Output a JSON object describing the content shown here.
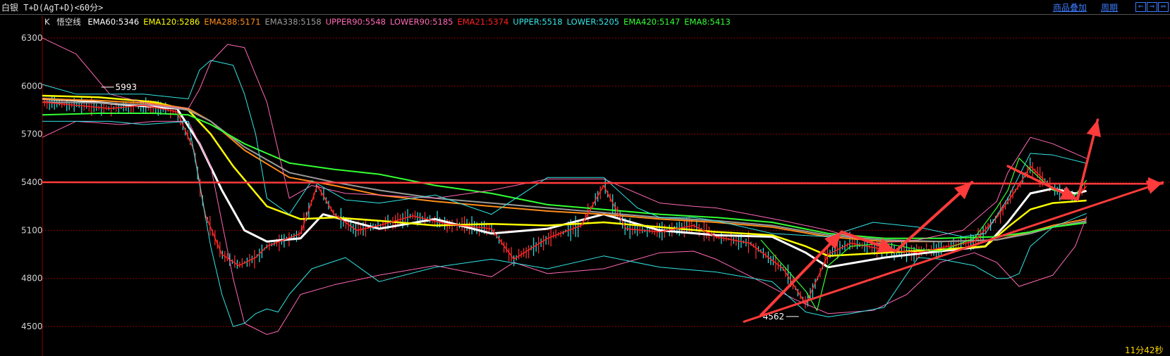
{
  "header": {
    "title": "白银 T+D(AgT+D)<60分>",
    "goods_overlay": "商品叠加",
    "period": "周期",
    "nav_left": "⇐",
    "nav_right": "⇒",
    "nav_fit": "⇔"
  },
  "legend": {
    "k_label": "K",
    "wukong_label": "悟空线",
    "items": [
      {
        "text": "EMA60:5346",
        "color": "#ffffff"
      },
      {
        "text": "EMA120:5286",
        "color": "#ffff00"
      },
      {
        "text": "EMA288:5171",
        "color": "#ff8c1a"
      },
      {
        "text": "EMA338:5158",
        "color": "#999999"
      },
      {
        "text": "UPPER90:5548",
        "color": "#ff69b4"
      },
      {
        "text": "LOWER90:5185",
        "color": "#ff69b4"
      },
      {
        "text": "EMA21:5374",
        "color": "#ff2020"
      },
      {
        "text": "UPPER:5518",
        "color": "#33e6e6"
      },
      {
        "text": "LOWER:5205",
        "color": "#33e6e6"
      },
      {
        "text": "EMA420:5147",
        "color": "#33ff33"
      },
      {
        "text": "EMA8:5413",
        "color": "#33ff33"
      }
    ]
  },
  "footer": {
    "time_remaining": "11分42秒"
  },
  "colors": {
    "background": "#000000",
    "grid": "#8b0000",
    "axis_text": "#cfcfcf",
    "arrow": "#ff3b3b",
    "candle_up": "#ff3333",
    "candle_down": "#33e6e6"
  },
  "chart_data": {
    "type": "line",
    "y_ticks": [
      4500,
      4800,
      5100,
      5400,
      5700,
      6000,
      6300
    ],
    "ylim": [
      4430,
      6370
    ],
    "grid": true,
    "annotations": [
      {
        "text": "5993",
        "x": 0.06,
        "y": 5993
      },
      {
        "text": "4562",
        "x": 0.67,
        "y": 4562
      }
    ],
    "series": [
      {
        "name": "EMA60",
        "color": "#ffffff",
        "x": [
          0,
          0.03,
          0.08,
          0.12,
          0.14,
          0.16,
          0.18,
          0.2,
          0.23,
          0.25,
          0.3,
          0.35,
          0.4,
          0.45,
          0.5,
          0.55,
          0.6,
          0.65,
          0.68,
          0.7,
          0.75,
          0.8,
          0.84,
          0.86,
          0.88,
          0.9,
          0.92,
          0.93
        ],
        "y": [
          5920,
          5910,
          5880,
          5860,
          5640,
          5350,
          5100,
          5030,
          5050,
          5200,
          5110,
          5170,
          5080,
          5110,
          5200,
          5100,
          5070,
          5060,
          4960,
          4870,
          4930,
          4970,
          5000,
          5150,
          5330,
          5360,
          5330,
          5346
        ]
      },
      {
        "name": "EMA120",
        "color": "#ffff00",
        "x": [
          0,
          0.05,
          0.1,
          0.13,
          0.15,
          0.17,
          0.2,
          0.23,
          0.26,
          0.3,
          0.35,
          0.4,
          0.45,
          0.5,
          0.55,
          0.6,
          0.65,
          0.68,
          0.7,
          0.75,
          0.8,
          0.84,
          0.86,
          0.88,
          0.9,
          0.93
        ],
        "y": [
          5940,
          5930,
          5900,
          5850,
          5700,
          5500,
          5250,
          5170,
          5180,
          5160,
          5130,
          5140,
          5130,
          5150,
          5120,
          5090,
          5070,
          5000,
          4940,
          4960,
          4980,
          5000,
          5120,
          5230,
          5270,
          5286
        ]
      },
      {
        "name": "EMA288",
        "color": "#ff8c1a",
        "x": [
          0,
          0.05,
          0.1,
          0.13,
          0.15,
          0.18,
          0.22,
          0.26,
          0.3,
          0.35,
          0.4,
          0.45,
          0.5,
          0.55,
          0.6,
          0.65,
          0.7,
          0.75,
          0.8,
          0.85,
          0.88,
          0.9,
          0.93
        ],
        "y": [
          5920,
          5910,
          5890,
          5860,
          5780,
          5600,
          5430,
          5380,
          5320,
          5280,
          5250,
          5220,
          5200,
          5170,
          5150,
          5120,
          5060,
          5030,
          5030,
          5040,
          5090,
          5130,
          5171
        ]
      },
      {
        "name": "EMA338",
        "color": "#999999",
        "x": [
          0,
          0.05,
          0.1,
          0.13,
          0.15,
          0.18,
          0.22,
          0.26,
          0.3,
          0.35,
          0.4,
          0.45,
          0.5,
          0.55,
          0.6,
          0.65,
          0.7,
          0.75,
          0.8,
          0.85,
          0.88,
          0.9,
          0.93
        ],
        "y": [
          5900,
          5895,
          5880,
          5850,
          5780,
          5620,
          5460,
          5400,
          5350,
          5300,
          5270,
          5240,
          5210,
          5180,
          5160,
          5130,
          5070,
          5040,
          5030,
          5040,
          5080,
          5120,
          5158
        ]
      },
      {
        "name": "EMA420",
        "color": "#33ff33",
        "x": [
          0,
          0.05,
          0.1,
          0.13,
          0.15,
          0.18,
          0.22,
          0.26,
          0.3,
          0.35,
          0.4,
          0.45,
          0.5,
          0.55,
          0.6,
          0.65,
          0.7,
          0.75,
          0.8,
          0.85,
          0.88,
          0.9,
          0.93
        ],
        "y": [
          5820,
          5830,
          5830,
          5820,
          5760,
          5640,
          5520,
          5480,
          5450,
          5380,
          5330,
          5260,
          5230,
          5200,
          5180,
          5150,
          5080,
          5050,
          5050,
          5060,
          5090,
          5120,
          5147
        ]
      },
      {
        "name": "EMA21",
        "color": "#ff2020",
        "x": [
          0,
          0.03,
          0.06,
          0.09,
          0.12,
          0.135,
          0.145,
          0.16,
          0.175,
          0.19,
          0.2,
          0.23,
          0.245,
          0.26,
          0.28,
          0.3,
          0.33,
          0.36,
          0.4,
          0.42,
          0.45,
          0.48,
          0.5,
          0.52,
          0.55,
          0.58,
          0.6,
          0.63,
          0.66,
          0.68,
          0.7,
          0.72,
          0.75,
          0.78,
          0.8,
          0.83,
          0.85,
          0.87,
          0.88,
          0.9,
          0.92,
          0.93
        ],
        "y": [
          5900,
          5880,
          5860,
          5880,
          5840,
          5600,
          5200,
          4950,
          4880,
          4930,
          5000,
          5080,
          5380,
          5200,
          5100,
          5130,
          5190,
          5140,
          5110,
          4920,
          5050,
          5130,
          5380,
          5110,
          5090,
          5130,
          5060,
          5020,
          4860,
          4640,
          4950,
          5020,
          4980,
          4960,
          4990,
          5030,
          5180,
          5380,
          5500,
          5360,
          5300,
          5374
        ]
      },
      {
        "name": "EMA8",
        "color": "#33ff33",
        "x": [
          0.64,
          0.66,
          0.68,
          0.69,
          0.7,
          0.72,
          0.75,
          0.78,
          0.8,
          0.83,
          0.85,
          0.86,
          0.87,
          0.88,
          0.9,
          0.92,
          0.93
        ],
        "y": [
          5040,
          4880,
          4720,
          4600,
          4880,
          5000,
          5020,
          4980,
          4970,
          5050,
          5240,
          5350,
          5550,
          5480,
          5350,
          5320,
          5413
        ]
      },
      {
        "name": "UPPER90",
        "color": "#ff69b4",
        "x": [
          0,
          0.03,
          0.06,
          0.1,
          0.13,
          0.14,
          0.15,
          0.165,
          0.18,
          0.2,
          0.21,
          0.22,
          0.24,
          0.27,
          0.3,
          0.35,
          0.4,
          0.45,
          0.5,
          0.55,
          0.58,
          0.6,
          0.63,
          0.66,
          0.7,
          0.74,
          0.78,
          0.82,
          0.85,
          0.86,
          0.88,
          0.9,
          0.93
        ],
        "y": [
          6300,
          6200,
          5950,
          5880,
          5860,
          5980,
          6150,
          6260,
          6240,
          5900,
          5600,
          5300,
          5380,
          5330,
          5320,
          5300,
          5350,
          5420,
          5420,
          5270,
          5250,
          5240,
          5200,
          5160,
          5100,
          5020,
          5040,
          5100,
          5280,
          5460,
          5680,
          5640,
          5548
        ]
      },
      {
        "name": "LOWER90",
        "color": "#ff69b4",
        "x": [
          0,
          0.03,
          0.07,
          0.1,
          0.13,
          0.15,
          0.17,
          0.18,
          0.2,
          0.21,
          0.23,
          0.26,
          0.3,
          0.35,
          0.4,
          0.42,
          0.45,
          0.5,
          0.55,
          0.58,
          0.6,
          0.64,
          0.67,
          0.7,
          0.74,
          0.77,
          0.8,
          0.83,
          0.85,
          0.87,
          0.9,
          0.92,
          0.93
        ],
        "y": [
          5680,
          5780,
          5760,
          5780,
          5780,
          5500,
          4800,
          4520,
          4450,
          4470,
          4700,
          4760,
          4820,
          4880,
          4810,
          4900,
          4830,
          4860,
          4960,
          4970,
          4920,
          4780,
          4670,
          4580,
          4600,
          4700,
          4900,
          4960,
          4900,
          4750,
          4820,
          5000,
          5185
        ]
      },
      {
        "name": "UPPER",
        "color": "#33e6e6",
        "x": [
          0,
          0.03,
          0.06,
          0.09,
          0.13,
          0.14,
          0.15,
          0.17,
          0.18,
          0.19,
          0.2,
          0.22,
          0.24,
          0.27,
          0.3,
          0.35,
          0.4,
          0.45,
          0.5,
          0.53,
          0.55,
          0.58,
          0.6,
          0.65,
          0.7,
          0.74,
          0.78,
          0.82,
          0.84,
          0.86,
          0.88,
          0.9,
          0.93
        ],
        "y": [
          6010,
          5950,
          5950,
          5950,
          5920,
          6100,
          6160,
          6130,
          5950,
          5700,
          5300,
          5200,
          5410,
          5290,
          5270,
          5320,
          5200,
          5430,
          5430,
          5240,
          5180,
          5180,
          5160,
          5080,
          5060,
          5150,
          5120,
          5060,
          5080,
          5300,
          5580,
          5570,
          5518
        ]
      },
      {
        "name": "LOWER",
        "color": "#33e6e6",
        "x": [
          0,
          0.03,
          0.06,
          0.09,
          0.13,
          0.15,
          0.16,
          0.17,
          0.18,
          0.19,
          0.2,
          0.21,
          0.22,
          0.24,
          0.27,
          0.3,
          0.35,
          0.4,
          0.45,
          0.5,
          0.55,
          0.6,
          0.65,
          0.68,
          0.7,
          0.72,
          0.75,
          0.78,
          0.8,
          0.83,
          0.85,
          0.86,
          0.87,
          0.88,
          0.9,
          0.93
        ],
        "y": [
          5780,
          5780,
          5780,
          5760,
          5780,
          5000,
          4700,
          4500,
          4520,
          4580,
          4610,
          4590,
          4700,
          4860,
          4930,
          4780,
          4870,
          4920,
          4860,
          4940,
          4870,
          4840,
          4780,
          4590,
          4560,
          4580,
          4620,
          4930,
          4920,
          4880,
          4800,
          4800,
          4830,
          5000,
          5120,
          5205
        ]
      }
    ]
  }
}
